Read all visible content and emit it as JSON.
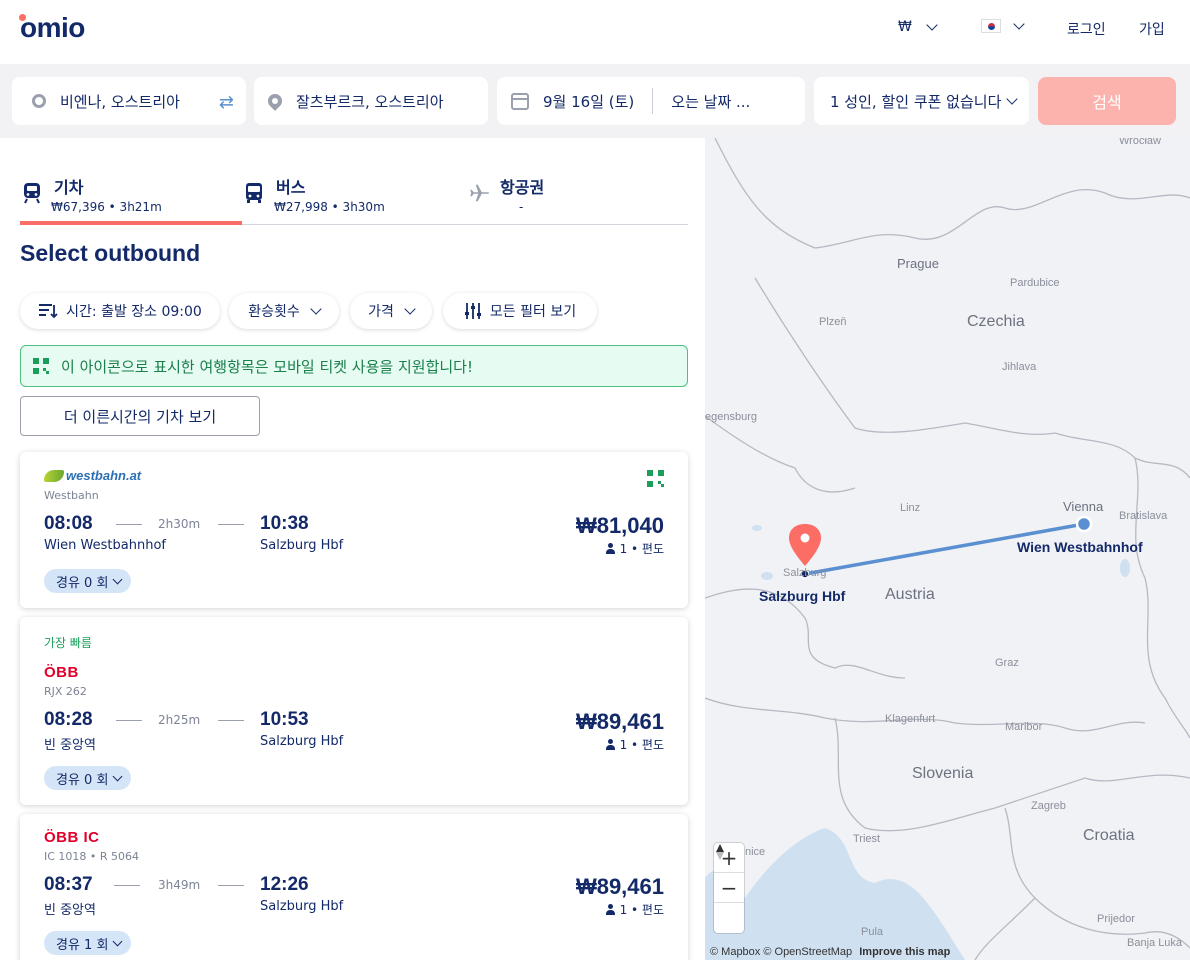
{
  "header": {
    "logo": "omio",
    "currency": "₩",
    "login": "로그인",
    "signup": "가입"
  },
  "search": {
    "from": "비엔나, 오스트리아",
    "to": "잘츠부르크, 오스트리아",
    "depart_date": "9월 16일 (토)",
    "return_date": "오는 날짜 ...",
    "passengers": "1 성인, 할인 쿠폰 없습니다",
    "button": "검색"
  },
  "tabs": [
    {
      "title": "기차",
      "sub": "₩67,396 • 3h21m",
      "icon": "train-icon"
    },
    {
      "title": "버스",
      "sub": "₩27,998 • 3h30m",
      "icon": "bus-icon"
    },
    {
      "title": "항공권",
      "sub": "-",
      "icon": "plane-icon"
    }
  ],
  "section_title": "Select outbound",
  "filters": {
    "time": "시간: 출발 장소 09:00",
    "transfers": "환승횟수",
    "price": "가격",
    "all": "모든 필터 보기"
  },
  "notice": "이 아이콘으로 표시한 여행항목은 모바일 티켓 사용을 지원합니다!",
  "earlier_button": "더 이른시간의 기차 보기",
  "results": [
    {
      "operator_logo": "westbahn.at",
      "operator_sub": "Westbahn",
      "badge": "",
      "dep_time": "08:08",
      "dep_station": "Wien Westbahnhof",
      "duration": "2h30m",
      "arr_time": "10:38",
      "arr_station": "Salzburg Hbf",
      "price": "₩81,040",
      "pax": "1 • 편도",
      "stops": "경유 0 회"
    },
    {
      "operator_logo": "ÖBB",
      "operator_sub": "RJX 262",
      "badge": "가장 빠름",
      "dep_time": "08:28",
      "dep_station": "빈 중앙역",
      "duration": "2h25m",
      "arr_time": "10:53",
      "arr_station": "Salzburg Hbf",
      "price": "₩89,461",
      "pax": "1 • 편도",
      "stops": "경유 0 회"
    },
    {
      "operator_logo": "ÖBB IC",
      "operator_sub": "IC 1018 • R 5064",
      "badge": "",
      "dep_time": "08:37",
      "dep_station": "빈 중앙역",
      "duration": "3h49m",
      "arr_time": "12:26",
      "arr_station": "Salzburg Hbf",
      "price": "₩89,461",
      "pax": "1 • 편도",
      "stops": "경유 1 회"
    }
  ],
  "map": {
    "labels": {
      "wroclaw": "Wrocław",
      "prague": "Prague",
      "pardubice": "Pardubice",
      "plzen": "Plzeň",
      "czechia": "Czechia",
      "jihlava": "Jihlava",
      "regensburg": "egensburg",
      "linz": "Linz",
      "vienna": "Vienna",
      "bratislava": "Bratislava",
      "austria": "Austria",
      "graz": "Graz",
      "klagenfurt": "Klagenfurt",
      "maribor": "Maribor",
      "slovenia": "Slovenia",
      "zagreb": "Zagreb",
      "croatia": "Croatia",
      "trieste": "Triest",
      "venice": "nice",
      "pula": "Pula",
      "prijedor": "Prijedor",
      "banjaluka": "Banja Luka",
      "salzburg_city": "Salzburg"
    },
    "origin_station": "Wien Westbahnhof",
    "destination_station": "Salzburg Hbf",
    "zoom_in": "+",
    "zoom_out": "−",
    "attribution": "© Mapbox © OpenStreetMap",
    "improve": "Improve this map",
    "route_color": "#5a8fd1",
    "pin_color": "#fc6d66"
  },
  "colors": {
    "brand_navy": "#132968",
    "accent_coral": "#fc6d66",
    "search_disabled": "#fcb3ae",
    "notice_green": "#1a9e5a"
  }
}
